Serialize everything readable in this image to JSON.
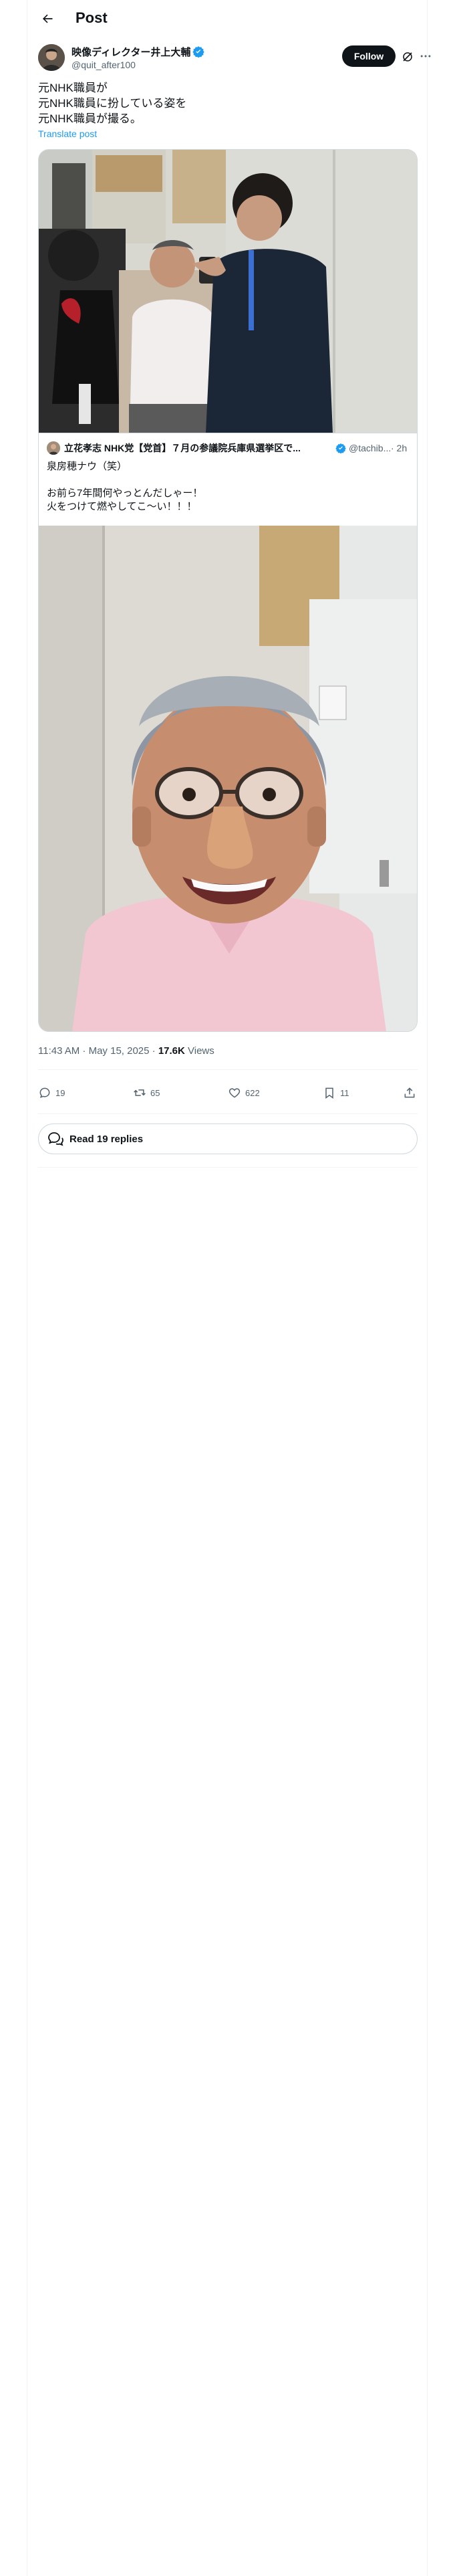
{
  "header": {
    "title": "Post"
  },
  "author": {
    "name": "映像ディレクター井上大輔",
    "handle": "@quit_after100",
    "follow_label": "Follow"
  },
  "post": {
    "lines": [
      "元NHK職員が",
      "元NHK職員に扮している姿を",
      "元NHK職員が撮る。"
    ],
    "translate_label": "Translate post"
  },
  "quote": {
    "name": "立花孝志 NHK党【党首】７月の参議院兵庫県選挙区で...",
    "handle": "@tachib...",
    "time": "· 2h",
    "lines": [
      "泉房穂ナウ（笑）",
      "",
      "お前ら7年間何やっとんだしゃー！",
      "火をつけて燃やしてこ〜い！！！"
    ]
  },
  "meta": {
    "time_date": "11:43 AM · May 15, 2025 · ",
    "views_count": "17.6K",
    "views_label": " Views"
  },
  "actions": {
    "replies": "19",
    "reposts": "65",
    "likes": "622",
    "bookmarks": "11"
  },
  "read_replies": {
    "label": "Read 19 replies"
  },
  "icons": [
    "back-arrow-icon",
    "verified-badge-icon",
    "grok-icon",
    "more-icon",
    "reply-icon",
    "repost-icon",
    "like-icon",
    "bookmark-icon",
    "share-icon",
    "chat-bubbles-icon"
  ],
  "colors": {
    "accent": "#1d9bf0",
    "text": "#0f1419",
    "secondary": "#536471",
    "border": "#cfd9de"
  }
}
